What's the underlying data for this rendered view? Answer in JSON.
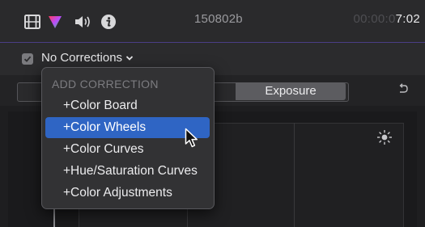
{
  "toolbar": {
    "icons": [
      "filmstrip-icon",
      "color-triangle-icon",
      "speaker-icon",
      "info-icon"
    ],
    "clip_name": "150802b",
    "timecode_dim": "00:00:0",
    "timecode_bright": "7:02"
  },
  "corrections": {
    "enabled": true,
    "label": "No Corrections"
  },
  "tabs": {
    "active_label": "Exposure"
  },
  "menu": {
    "header": "ADD CORRECTION",
    "items": [
      {
        "label": "+Color Board",
        "selected": false
      },
      {
        "label": "+Color Wheels",
        "selected": true
      },
      {
        "label": "+Color Curves",
        "selected": false
      },
      {
        "label": "+Hue/Saturation Curves",
        "selected": false
      },
      {
        "label": "+Color Adjustments",
        "selected": false
      }
    ]
  },
  "colors": {
    "accent_selection": "#2f65c4",
    "toolbar_divider": "#4a3e86"
  }
}
